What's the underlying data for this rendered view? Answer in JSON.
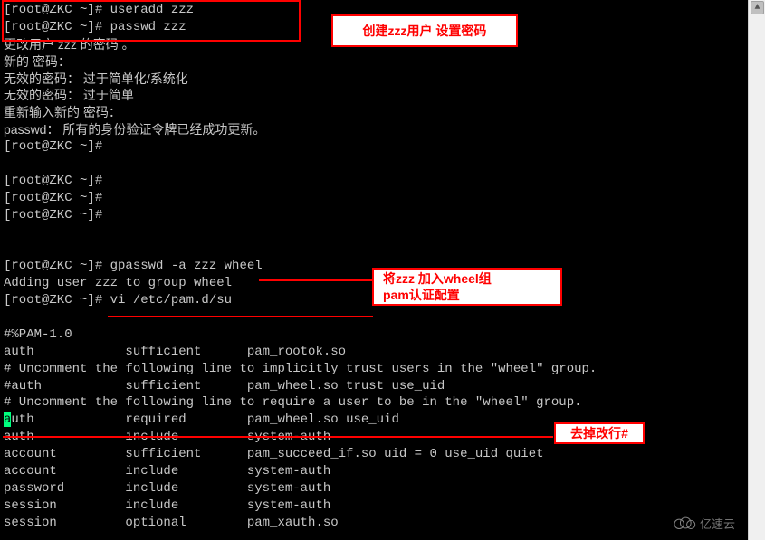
{
  "terminal": {
    "lines": [
      "[root@ZKC ~]# useradd zzz",
      "[root@ZKC ~]# passwd zzz",
      "更改用户 zzz 的密码 。",
      "新的 密码：",
      "无效的密码： 过于简单化/系统化",
      "无效的密码： 过于简单",
      "重新输入新的 密码：",
      "passwd： 所有的身份验证令牌已经成功更新。",
      "[root@ZKC ~]#",
      "",
      "[root@ZKC ~]#",
      "[root@ZKC ~]#",
      "[root@ZKC ~]#",
      "",
      "",
      "[root@ZKC ~]# gpasswd -a zzz wheel",
      "Adding user zzz to group wheel",
      "[root@ZKC ~]# vi /etc/pam.d/su",
      "",
      "#%PAM-1.0",
      "auth            sufficient      pam_rootok.so",
      "# Uncomment the following line to implicitly trust users in the \"wheel\" group.",
      "#auth           sufficient      pam_wheel.so trust use_uid",
      "# Uncomment the following line to require a user to be in the \"wheel\" group.",
      "auth            required        pam_wheel.so use_uid",
      "auth            include         system-auth",
      "account         sufficient      pam_succeed_if.so uid = 0 use_uid quiet",
      "account         include         system-auth",
      "password        include         system-auth",
      "session         include         system-auth",
      "session         optional        pam_xauth.so"
    ],
    "highlight_line_index": 24,
    "highlight_char": "a"
  },
  "callouts": {
    "c1": "创建zzz用户 设置密码",
    "c2a": "将zzz 加入wheel组",
    "c2b": "pam认证配置",
    "c3": "去掉改行#"
  },
  "watermark": {
    "text": "亿速云"
  },
  "scroll": {
    "arrow": "▲"
  }
}
